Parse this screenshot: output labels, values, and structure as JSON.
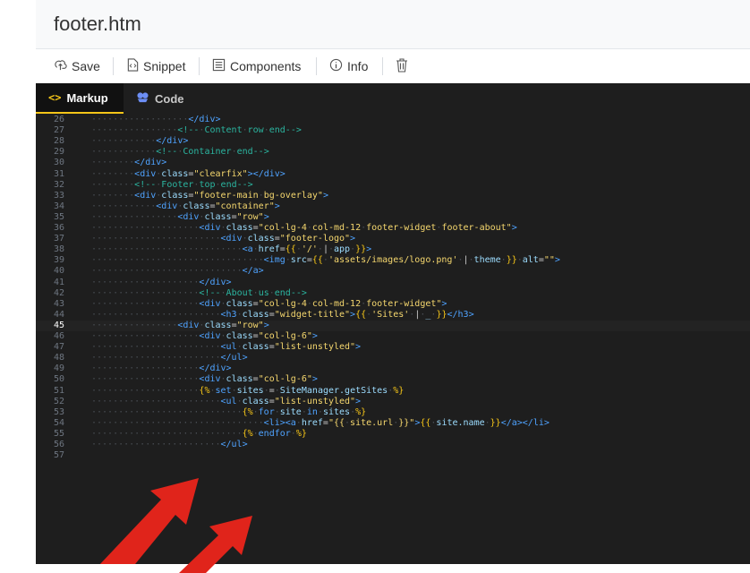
{
  "title": "footer.htm",
  "toolbar": {
    "save": "Save",
    "snippet": "Snippet",
    "components": "Components",
    "info": "Info"
  },
  "tabs": {
    "markup": "Markup",
    "code": "Code"
  },
  "colors": {
    "tag": "#4fa3ff",
    "attr": "#9cdcfe",
    "string": "#f5d76e",
    "comment": "#2bb5a0",
    "twig": "#f5c518",
    "arrow": "#e0241b"
  },
  "current_line": "45",
  "lines": [
    {
      "n": "26",
      "c": "··················</div>"
    },
    {
      "n": "27",
      "c": "················<!--·Content·row·end-->"
    },
    {
      "n": "28",
      "c": "············</div>"
    },
    {
      "n": "29",
      "c": "············<!--·Container·end-->"
    },
    {
      "n": "30",
      "c": "········</div>"
    },
    {
      "n": "31",
      "c": "········<div·class=\"clearfix\"></div>"
    },
    {
      "n": "32",
      "c": "········<!--·Footer·top·end-->"
    },
    {
      "n": "33",
      "c": "········<div·class=\"footer-main·bg-overlay\">"
    },
    {
      "n": "34",
      "c": "············<div·class=\"container\">"
    },
    {
      "n": "35",
      "c": "················<div·class=\"row\">"
    },
    {
      "n": "36",
      "c": "····················<div·class=\"col-lg-4·col-md-12·footer-widget·footer-about\">"
    },
    {
      "n": "37",
      "c": "························<div·class=\"footer-logo\">"
    },
    {
      "n": "38",
      "c": "····························<a·href={{·'/'·|·app·}}>"
    },
    {
      "n": "39",
      "c": "································<img·src={{·'assets/images/logo.png'·|·theme·}}·alt=\"\">"
    },
    {
      "n": "40",
      "c": "····························</a>"
    },
    {
      "n": "41",
      "c": "····················</div>"
    },
    {
      "n": "42",
      "c": "····················<!--·About·us·end-->"
    },
    {
      "n": "43",
      "c": "····················<div·class=\"col-lg-4·col-md-12·footer-widget\">"
    },
    {
      "n": "44",
      "c": "························<h3·class=\"widget-title\">{{·'Sites'·|·_·}}</h3>"
    },
    {
      "n": "45",
      "c": "················<div·class=\"row\">"
    },
    {
      "n": "46",
      "c": "····················<div·class=\"col-lg-6\">"
    },
    {
      "n": "47",
      "c": "························<ul·class=\"list-unstyled\">"
    },
    {
      "n": "48",
      "c": "························</ul>"
    },
    {
      "n": "49",
      "c": "····················</div>"
    },
    {
      "n": "50",
      "c": "····················<div·class=\"col-lg-6\">"
    },
    {
      "n": "51",
      "c": "····················{%·set·sites·=·SiteManager.getSites·%}"
    },
    {
      "n": "52",
      "c": "························<ul·class=\"list-unstyled\">"
    },
    {
      "n": "53",
      "c": "····························{%·for·site·in·sites·%}"
    },
    {
      "n": "54",
      "c": "································<li><a·href=\"{{·site.url·}}\">{{·site.name·}}</a></li>"
    },
    {
      "n": "55",
      "c": "····························{%·endfor·%}"
    },
    {
      "n": "56",
      "c": "························</ul>"
    },
    {
      "n": "57",
      "c": ""
    }
  ]
}
